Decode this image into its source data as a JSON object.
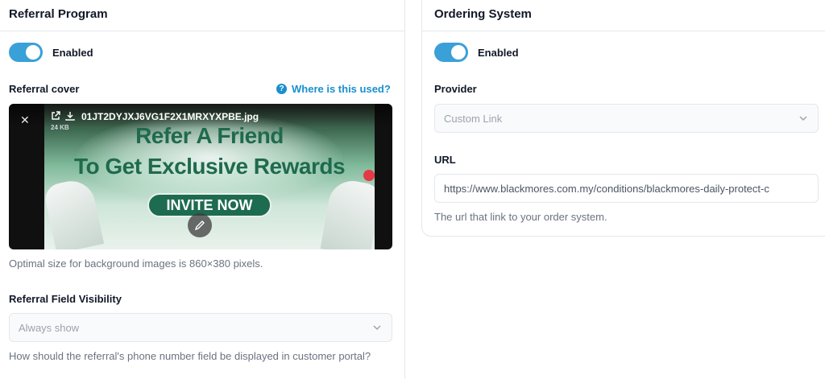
{
  "referral": {
    "title": "Referral Program",
    "toggle_label": "Enabled",
    "cover_label": "Referral cover",
    "help_link": "Where is this used?",
    "file_name": "01JT2DYJXJ6VG1F2X1MRXYXPBE.jpg",
    "file_size": "24 KB",
    "cover_heading_1": "Refer A Friend",
    "cover_heading_2": "To Get Exclusive Rewards",
    "cover_button": "INVITE NOW",
    "cover_hint": "Optimal size for background images is 860×380 pixels.",
    "visibility_label": "Referral Field Visibility",
    "visibility_value": "Always show",
    "visibility_hint": "How should the referral's phone number field be displayed in customer portal?"
  },
  "ordering": {
    "title": "Ordering System",
    "toggle_label": "Enabled",
    "provider_label": "Provider",
    "provider_value": "Custom Link",
    "url_label": "URL",
    "url_value": "https://www.blackmores.com.my/conditions/blackmores-daily-protect-c",
    "url_hint": "The url that link to your order system."
  },
  "colors": {
    "accent": "#3aa0d8",
    "link": "#1a8fcf",
    "cover_green": "#1f6a4e"
  }
}
